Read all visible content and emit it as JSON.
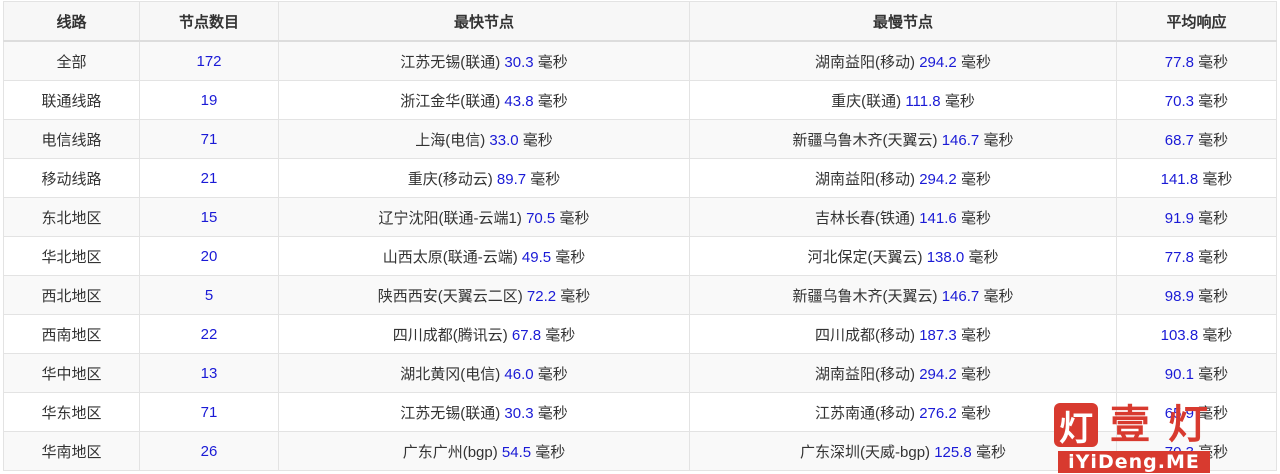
{
  "table": {
    "headers": [
      "线路",
      "节点数目",
      "最快节点",
      "最慢节点",
      "平均响应"
    ],
    "unit": "毫秒",
    "rows": [
      {
        "line": "全部",
        "count": "172",
        "fast_name": "江苏无锡(联通)",
        "fast_ms": "30.3",
        "slow_name": "湖南益阳(移动)",
        "slow_ms": "294.2",
        "avg_ms": "77.8"
      },
      {
        "line": "联通线路",
        "count": "19",
        "fast_name": "浙江金华(联通)",
        "fast_ms": "43.8",
        "slow_name": "重庆(联通)",
        "slow_ms": "111.8",
        "avg_ms": "70.3"
      },
      {
        "line": "电信线路",
        "count": "71",
        "fast_name": "上海(电信)",
        "fast_ms": "33.0",
        "slow_name": "新疆乌鲁木齐(天翼云)",
        "slow_ms": "146.7",
        "avg_ms": "68.7"
      },
      {
        "line": "移动线路",
        "count": "21",
        "fast_name": "重庆(移动云)",
        "fast_ms": "89.7",
        "slow_name": "湖南益阳(移动)",
        "slow_ms": "294.2",
        "avg_ms": "141.8"
      },
      {
        "line": "东北地区",
        "count": "15",
        "fast_name": "辽宁沈阳(联通-云端1)",
        "fast_ms": "70.5",
        "slow_name": "吉林长春(铁通)",
        "slow_ms": "141.6",
        "avg_ms": "91.9"
      },
      {
        "line": "华北地区",
        "count": "20",
        "fast_name": "山西太原(联通-云端)",
        "fast_ms": "49.5",
        "slow_name": "河北保定(天翼云)",
        "slow_ms": "138.0",
        "avg_ms": "77.8"
      },
      {
        "line": "西北地区",
        "count": "5",
        "fast_name": "陕西西安(天翼云二区)",
        "fast_ms": "72.2",
        "slow_name": "新疆乌鲁木齐(天翼云)",
        "slow_ms": "146.7",
        "avg_ms": "98.9"
      },
      {
        "line": "西南地区",
        "count": "22",
        "fast_name": "四川成都(腾讯云)",
        "fast_ms": "67.8",
        "slow_name": "四川成都(移动)",
        "slow_ms": "187.3",
        "avg_ms": "103.8"
      },
      {
        "line": "华中地区",
        "count": "13",
        "fast_name": "湖北黄冈(电信)",
        "fast_ms": "46.0",
        "slow_name": "湖南益阳(移动)",
        "slow_ms": "294.2",
        "avg_ms": "90.1"
      },
      {
        "line": "华东地区",
        "count": "71",
        "fast_name": "江苏无锡(联通)",
        "fast_ms": "30.3",
        "slow_name": "江苏南通(移动)",
        "slow_ms": "276.2",
        "avg_ms": "65.9"
      },
      {
        "line": "华南地区",
        "count": "26",
        "fast_name": "广东广州(bgp)",
        "fast_ms": "54.5",
        "slow_name": "广东深圳(天威-bgp)",
        "slow_ms": "125.8",
        "avg_ms": "70.3"
      }
    ]
  },
  "watermark": {
    "char1": "灯",
    "char2": "壹",
    "char3": "灯",
    "text": "iYiDeng.ME"
  },
  "colors": {
    "value": "#1a1ad6",
    "brand": "#d83a2f"
  }
}
